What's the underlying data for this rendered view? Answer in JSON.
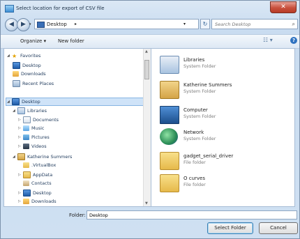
{
  "window": {
    "title": "Select location for export of CSV file",
    "close_glyph": "✕"
  },
  "address": {
    "crumb": "Desktop",
    "arrow": "▸",
    "dropdown": "▾",
    "refresh": "↻",
    "search_placeholder": "Search Desktop"
  },
  "nav": {
    "back": "◀",
    "forward": "▶",
    "history": "▾"
  },
  "toolbar": {
    "organize": "Organize ▾",
    "new_folder": "New folder",
    "views": "☷ ▾",
    "help": "?"
  },
  "tree": [
    {
      "label": "Favorites",
      "expander": "◢",
      "icon": "star-icon"
    },
    {
      "label": "Desktop",
      "expander": "",
      "icon": "desktop-icon"
    },
    {
      "label": "Downloads",
      "expander": "",
      "icon": "downloads-icon"
    },
    {
      "label": "Recent Places",
      "expander": "",
      "icon": "recent-places-icon"
    },
    {
      "label": "Desktop",
      "expander": "◢",
      "icon": "desktop-icon"
    },
    {
      "label": "Libraries",
      "expander": "◢",
      "icon": "libraries-icon"
    },
    {
      "label": "Documents",
      "expander": "▷",
      "icon": "documents-icon"
    },
    {
      "label": "Music",
      "expander": "▷",
      "icon": "music-icon"
    },
    {
      "label": "Pictures",
      "expander": "▷",
      "icon": "pictures-icon"
    },
    {
      "label": "Videos",
      "expander": "▷",
      "icon": "videos-icon"
    },
    {
      "label": "Katherine Summers",
      "expander": "◢",
      "icon": "user-folder-icon"
    },
    {
      "label": ".VirtualBox",
      "expander": "",
      "icon": "folder-icon"
    },
    {
      "label": "AppData",
      "expander": "▷",
      "icon": "folder-icon"
    },
    {
      "label": "Contacts",
      "expander": "",
      "icon": "contacts-icon"
    },
    {
      "label": "Desktop",
      "expander": "▷",
      "icon": "desktop-icon"
    },
    {
      "label": "Downloads",
      "expander": "▷",
      "icon": "downloads-icon"
    }
  ],
  "items": [
    {
      "name": "Libraries",
      "type": "System Folder",
      "icon": "libraries-icon"
    },
    {
      "name": "Katherine Summers",
      "type": "System Folder",
      "icon": "user-folder-icon"
    },
    {
      "name": "Computer",
      "type": "System Folder",
      "icon": "computer-icon"
    },
    {
      "name": "Network",
      "type": "System Folder",
      "icon": "network-icon"
    },
    {
      "name": "gadget_serial_driver",
      "type": "File folder",
      "icon": "folder-icon"
    },
    {
      "name": "O curves",
      "type": "File folder",
      "icon": "folder-icon"
    }
  ],
  "footer": {
    "folder_label": "Folder:",
    "folder_value": "Desktop",
    "select_button": "Select Folder",
    "cancel_button": "Cancel"
  }
}
